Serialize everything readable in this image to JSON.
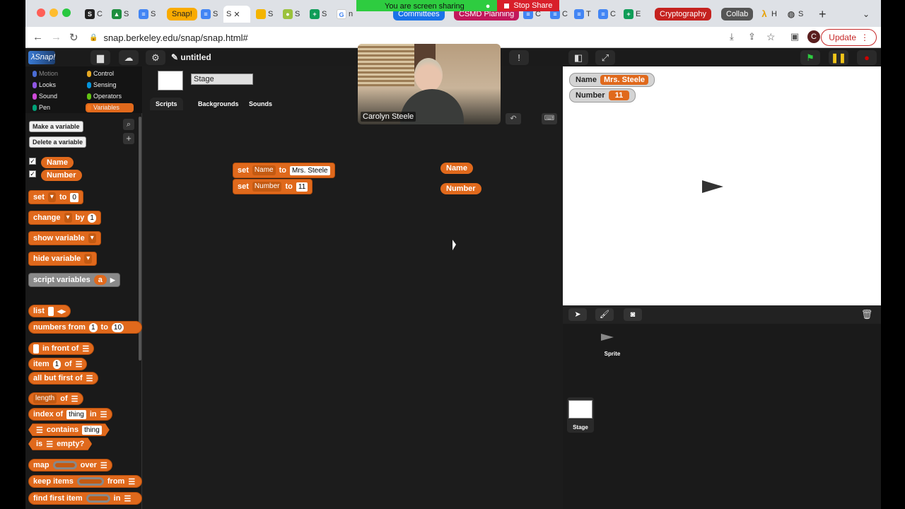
{
  "browser": {
    "tabs": [
      {
        "label": "C",
        "icon": "s-icon"
      },
      {
        "label": "S",
        "icon": "drive-icon"
      },
      {
        "label": "S",
        "icon": "docs-icon"
      },
      {
        "label": "Snap!",
        "icon": "pill-snap"
      },
      {
        "label": "S",
        "icon": "docs-icon"
      },
      {
        "label": "S",
        "icon": "active-tab"
      },
      {
        "label": "S",
        "icon": "slides-icon"
      },
      {
        "label": "S",
        "icon": "pear-icon"
      },
      {
        "label": "S",
        "icon": "sheets-icon"
      },
      {
        "label": "n",
        "icon": "google-icon"
      },
      {
        "label": "C",
        "icon": "docs-icon"
      },
      {
        "label": "C",
        "icon": "docs-icon"
      },
      {
        "label": "C",
        "icon": "docs-icon"
      },
      {
        "label": "T",
        "icon": "docs-icon"
      },
      {
        "label": "C",
        "icon": "docs-icon"
      },
      {
        "label": "E",
        "icon": "sheets-icon"
      },
      {
        "label": "H",
        "icon": "lambda-icon"
      },
      {
        "label": "S",
        "icon": "globe-icon"
      }
    ],
    "group_pills": {
      "snap": "Snap!",
      "committees": "Committees",
      "csmd": "CSMD Planning",
      "crypto": "Cryptography",
      "collab": "Collab"
    },
    "share_banner": "You are screen sharing",
    "stop_share": "Stop Share",
    "url": "snap.berkeley.edu/snap/snap.html#",
    "profile_initial": "C",
    "update_label": "Update"
  },
  "snap": {
    "project_title": "untitled",
    "sprite_name": "Stage",
    "tabs": [
      "Scripts",
      "Backgrounds",
      "Sounds"
    ],
    "categories": [
      "Motion",
      "Looks",
      "Sound",
      "Pen",
      "Control",
      "Sensing",
      "Operators",
      "Variables"
    ],
    "make_variable": "Make a variable",
    "delete_variable": "Delete a variable",
    "variables": [
      "Name",
      "Number"
    ],
    "palette_blocks": {
      "set": "set",
      "to": "to",
      "set_value": "0",
      "change": "change",
      "by": "by",
      "change_value": "1",
      "show_variable": "show variable",
      "hide_variable": "hide variable",
      "script_variables": "script variables",
      "script_var": "a",
      "list": "list",
      "numbers_from": "numbers from",
      "nf_a": "1",
      "nf_to": "to",
      "nf_b": "10",
      "in_front_of": "in front of",
      "item": "item",
      "item_val": "1",
      "of": "of",
      "all_but_first": "all but first of",
      "length": "length",
      "length_of": "of",
      "index_of": "index of",
      "thing": "thing",
      "in": "in",
      "contains": "contains",
      "is_empty": "is",
      "empty": "empty?",
      "map": "map",
      "over": "over",
      "keep_items": "keep items",
      "from": "from",
      "find_first": "find first item"
    },
    "script_blocks": {
      "set1_label": "set",
      "set1_var": "Name",
      "set1_to": "to",
      "set1_val": "Mrs. Steele",
      "set2_label": "set",
      "set2_var": "Number",
      "set2_to": "to",
      "set2_val": "11"
    },
    "free_reporters": [
      "Name",
      "Number"
    ],
    "watchers": [
      {
        "name": "Name",
        "value": "Mrs. Steele"
      },
      {
        "name": "Number",
        "value": "11"
      }
    ],
    "corral": {
      "sprite_label": "Sprite",
      "stage_label": "Stage"
    },
    "webcam_name": "Carolyn Steele"
  }
}
